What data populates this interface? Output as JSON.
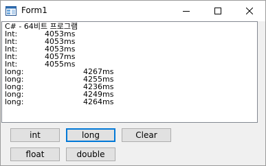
{
  "window": {
    "title": "Form1"
  },
  "output": {
    "heading": "C# - 64비트 프로그램",
    "int_lines": [
      {
        "label": "Int:",
        "value": "4053ms"
      },
      {
        "label": "Int:",
        "value": "4053ms"
      },
      {
        "label": "Int:",
        "value": "4053ms"
      },
      {
        "label": "Int:",
        "value": "4057ms"
      },
      {
        "label": "Int:",
        "value": "4055ms"
      }
    ],
    "long_lines": [
      {
        "label": "long:",
        "value": "4267ms"
      },
      {
        "label": "long:",
        "value": "4255ms"
      },
      {
        "label": "long:",
        "value": "4236ms"
      },
      {
        "label": "long:",
        "value": "4249ms"
      },
      {
        "label": "long:",
        "value": "4264ms"
      }
    ]
  },
  "buttons": {
    "int": "int",
    "long": "long",
    "clear": "Clear",
    "float": "float",
    "double": "double"
  },
  "colors": {
    "focus_border": "#0078d7",
    "button_face": "#e1e1e1"
  }
}
